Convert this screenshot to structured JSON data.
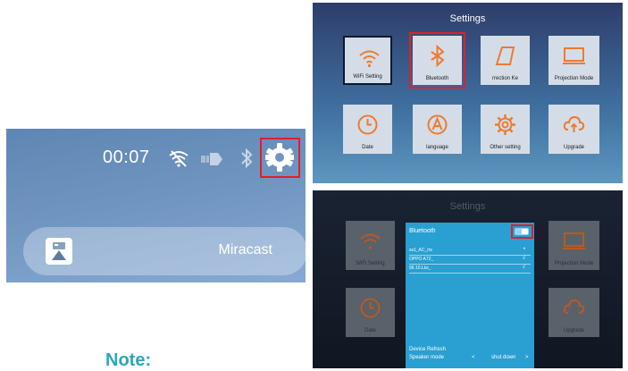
{
  "status_bar": {
    "time": "00:07",
    "icons": [
      "wifi-off-icon",
      "hdmi-input-icon",
      "bluetooth-icon",
      "gear-icon"
    ]
  },
  "miracast": {
    "label": "Miracast",
    "icon": "cast-icon"
  },
  "note": {
    "label": "Note:"
  },
  "settings": {
    "title": "Settings",
    "tiles": [
      {
        "label": "WiFi Setting",
        "icon": "wifi-icon"
      },
      {
        "label": "Bluetooth",
        "icon": "bluetooth-icon"
      },
      {
        "label": "rrection     Ke",
        "icon": "keystone-icon"
      },
      {
        "label": "Projection Mode",
        "icon": "projection-icon"
      },
      {
        "label": "Date",
        "icon": "clock-icon"
      },
      {
        "label": "language",
        "icon": "language-icon"
      },
      {
        "label": "Other setting",
        "icon": "cog-icon"
      },
      {
        "label": "Upgrade",
        "icon": "upgrade-icon"
      }
    ]
  },
  "bluetooth_dialog": {
    "background_title": "Settings",
    "title": "Bluetooth",
    "toggle_state": "on",
    "devices": [
      {
        "name": "ss1_AC_rts",
        "mark": ""
      },
      {
        "name": "OPPO A72_",
        "mark": ""
      },
      {
        "name": "96.10.Lks_",
        "mark": ""
      }
    ],
    "device_refresh": "Device Refresh",
    "speaker_mode_label": "Speaker mode",
    "speaker_mode_value": "shut down",
    "prev_arrow": "<",
    "next_arrow": ">",
    "bg_tiles": [
      {
        "label": "WiFi Setting",
        "icon": "wifi-icon"
      },
      {
        "label": "Projection Mode",
        "icon": "projection-icon"
      },
      {
        "label": "Date",
        "icon": "clock-icon"
      },
      {
        "label": "Upgrade",
        "icon": "upgrade-icon"
      }
    ]
  },
  "colors": {
    "highlight": "#e21f26",
    "orange_icon": "#f07a2c",
    "dialog_blue": "#2a9fd1",
    "note_teal": "#2aa7b7"
  }
}
